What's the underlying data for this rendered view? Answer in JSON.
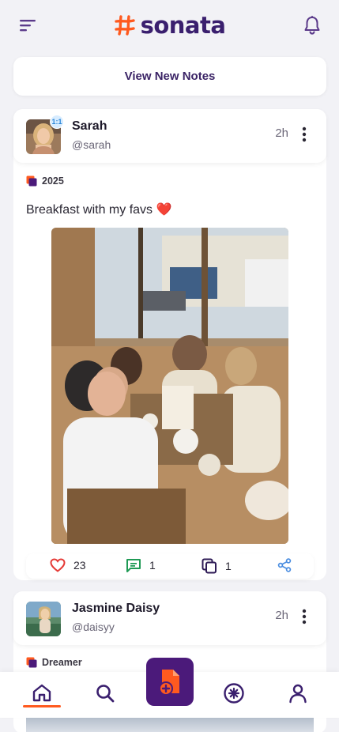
{
  "app": {
    "name": "sonata",
    "brand_color": "#ff5a1f",
    "primary_color": "#4b1a7a"
  },
  "header": {
    "menu_icon": "menu-icon",
    "notifications_icon": "bell-icon"
  },
  "feed": {
    "view_new_label": "View New Notes",
    "posts": [
      {
        "author": "Sarah",
        "handle": "@sarah",
        "badge": "1:1",
        "time": "2h",
        "category": "2025",
        "text": "Breakfast with my favs ❤️",
        "likes": "23",
        "comments": "1",
        "collections": "1"
      },
      {
        "author": "Jasmine Daisy",
        "handle": "@daisyy",
        "time": "2h",
        "category": "Dreamer"
      }
    ]
  },
  "bottom_nav": {
    "items": [
      "home-icon",
      "search-icon",
      "create-note-icon",
      "explore-icon",
      "profile-icon"
    ],
    "active": "home"
  }
}
